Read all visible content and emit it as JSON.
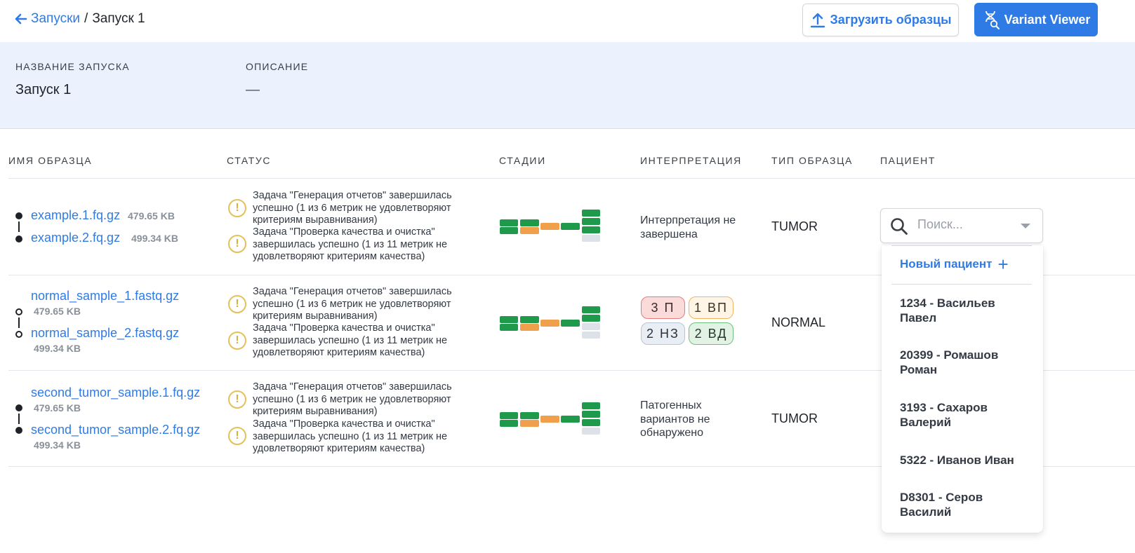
{
  "breadcrumb": {
    "parent": "Запуски",
    "separator": "/",
    "current": "Запуск 1"
  },
  "toolbar": {
    "upload_label": "Загрузить образцы",
    "viewer_label": "Variant Viewer"
  },
  "info": {
    "name_label": "НАЗВАНИЕ ЗАПУСКА",
    "name_value": "Запуск 1",
    "desc_label": "ОПИСАНИЕ",
    "desc_value": "—"
  },
  "table": {
    "headers": {
      "sample": "ИМЯ ОБРАЗЦА",
      "status": "СТАТУС",
      "stages": "СТАДИИ",
      "interpretation": "ИНТЕРПРЕТАЦИЯ",
      "type": "ТИП ОБРАЗЦА",
      "patient": "ПАЦИЕНТ"
    },
    "rows": [
      {
        "file1": "example.1.fq.gz",
        "size1": "479.65 KB",
        "file2": "example.2.fq.gz",
        "size2": "499.34 KB",
        "status1": "Задача \"Генерация отчетов\" завершилась успешно (1 из 6 метрик не удовлетворяют критериям выравнивания)",
        "status2": "Задача \"Проверка качества и очистка\" завершилась успешно (1 из 11 метрик не удовлетворяют критериям качества)",
        "interpretation": "Интерпретация не завершена",
        "type": "TUMOR"
      },
      {
        "file1": "normal_sample_1.fastq.gz",
        "size1": "479.65 KB",
        "file2": "normal_sample_2.fastq.gz",
        "size2": "499.34 KB",
        "status1": "Задача \"Генерация отчетов\" завершилась успешно (1 из 6 метрик не удовлетворяют критериям выравнивания)",
        "status2": "Задача \"Проверка качества и очистка\" завершилась успешно (1 из 11 метрик не удовлетворяют критериям качества)",
        "badges": {
          "p": "3 П",
          "vp": "1 ВП",
          "nz": "2 НЗ",
          "vd": "2 ВД"
        },
        "type": "NORMAL"
      },
      {
        "file1": "second_tumor_sample.1.fq.gz",
        "size1": "479.65 KB",
        "file2": "second_tumor_sample.2.fq.gz",
        "size2": "499.34 KB",
        "status1": "Задача \"Генерация отчетов\" завершилась успешно (1 из 6 метрик не удовлетворяют критериям выравнивания)",
        "status2": "Задача \"Проверка качества и очистка\" завершилась успешно (1 из 11 метрик не удовлетворяют критериям качества)",
        "interpretation": "Патогенных вариантов не обнаружено",
        "type": "TUMOR"
      }
    ]
  },
  "patient_select": {
    "placeholder": "Поиск...",
    "new_patient": "Новый пациент",
    "options": [
      "1234 - Васильев Павел",
      "20399 - Ромашов Роман",
      "3193 - Сахаров Валерий",
      "5322 - Иванов Иван",
      "D8301 - Серов Василий"
    ]
  },
  "colors": {
    "accent": "#2f7be5",
    "stage_green": "#1f9a4a",
    "stage_orange": "#f0a04b",
    "stage_gray": "#dde2e8",
    "warning": "#e2c15a"
  }
}
